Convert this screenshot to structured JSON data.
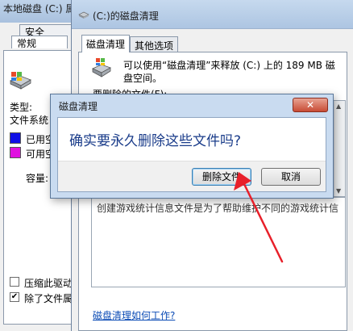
{
  "props_window": {
    "title": "本地磁盘 (C:) 属性",
    "tab_security": "安全",
    "tab_general": "常规",
    "type_label": "类型:",
    "filesystem_label": "文件系统",
    "used_label": "已用空",
    "free_label": "可用空",
    "capacity_label": "容量:",
    "compress_label": "压缩此驱动",
    "index_label": "除了文件属",
    "compress_checked": false,
    "index_checked": true,
    "used_color": "#1010e6",
    "free_color": "#e010e0"
  },
  "cleanup_window": {
    "title": "(C:)的磁盘清理",
    "tabs": [
      {
        "label": "磁盘清理",
        "active": true
      },
      {
        "label": "其他选项",
        "active": false
      }
    ],
    "description_line1": "可以使用“磁盘清理”来释放  (C:) 上的 189 MB 磁",
    "description_line2": "盘空间。",
    "files_to_delete_label": "要删除的文件(F):",
    "item_description": "创建游戏统计信息文件是为了帮助维护不同的游戏统计信息。",
    "help_link": "磁盘清理如何工作?"
  },
  "dialog": {
    "title": "磁盘清理",
    "close_glyph": "✕",
    "question": "确实要永久删除这些文件吗?",
    "delete_button": "删除文件",
    "cancel_button": "取消"
  },
  "colors": {
    "annotation_arrow": "#e8202a",
    "title_bar": "#bcd2ec",
    "link": "#0b4bb5"
  },
  "icons": {
    "drive": "drive-icon",
    "broom": "disk-cleanup-icon",
    "close": "close-icon",
    "arrow": "annotation-arrow"
  }
}
